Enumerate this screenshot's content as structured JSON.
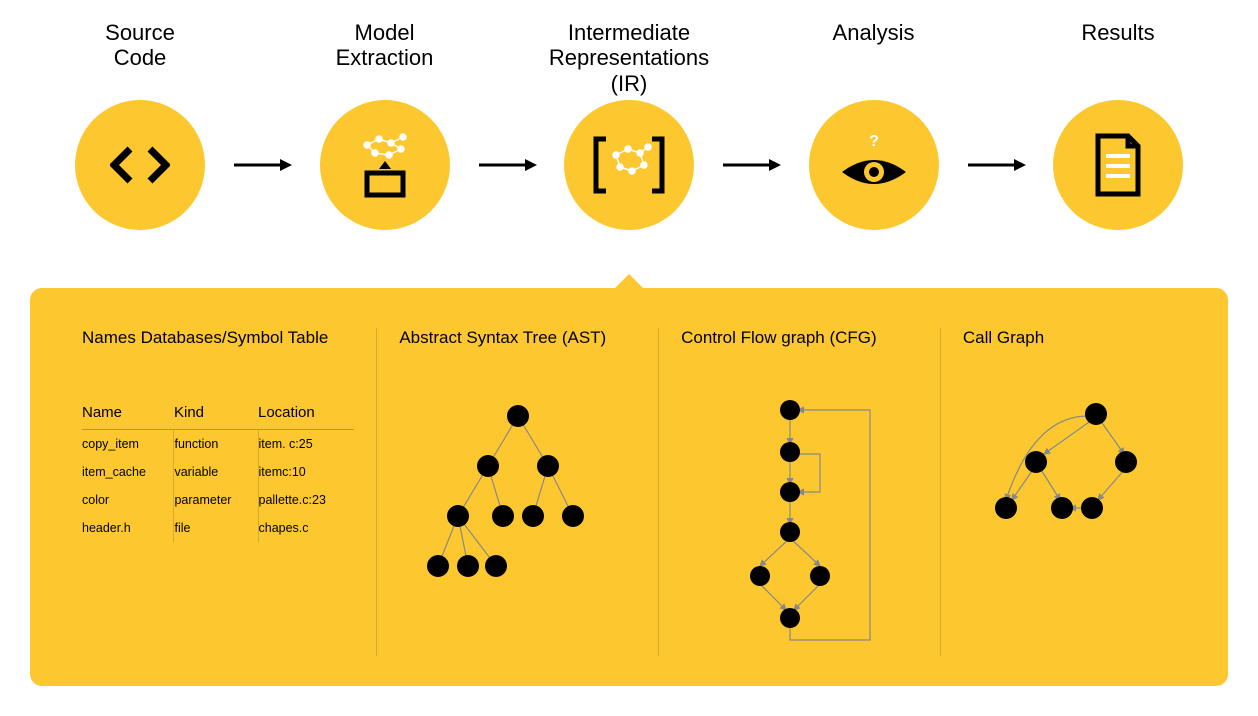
{
  "stages": {
    "source_code": "Source\nCode",
    "model_extraction": "Model\nExtraction",
    "ir": "Intermediate\nRepresentations\n(IR)",
    "analysis": "Analysis",
    "results": "Results"
  },
  "detail": {
    "symbol_table": {
      "title": "Names Databases/Symbol Table",
      "headers": {
        "name": "Name",
        "kind": "Kind",
        "location": "Location"
      },
      "rows": [
        {
          "name": "copy_item",
          "kind": "function",
          "location": "item. c:25"
        },
        {
          "name": "item_cache",
          "kind": "variable",
          "location": "itemc:10"
        },
        {
          "name": "color",
          "kind": "parameter",
          "location": "pallette.c:23"
        },
        {
          "name": "header.h",
          "kind": "file",
          "location": "chapes.c"
        }
      ]
    },
    "ast": {
      "title": "Abstract Syntax Tree (AST)"
    },
    "cfg": {
      "title": "Control Flow graph (CFG)"
    },
    "call_graph": {
      "title": "Call Graph"
    }
  }
}
